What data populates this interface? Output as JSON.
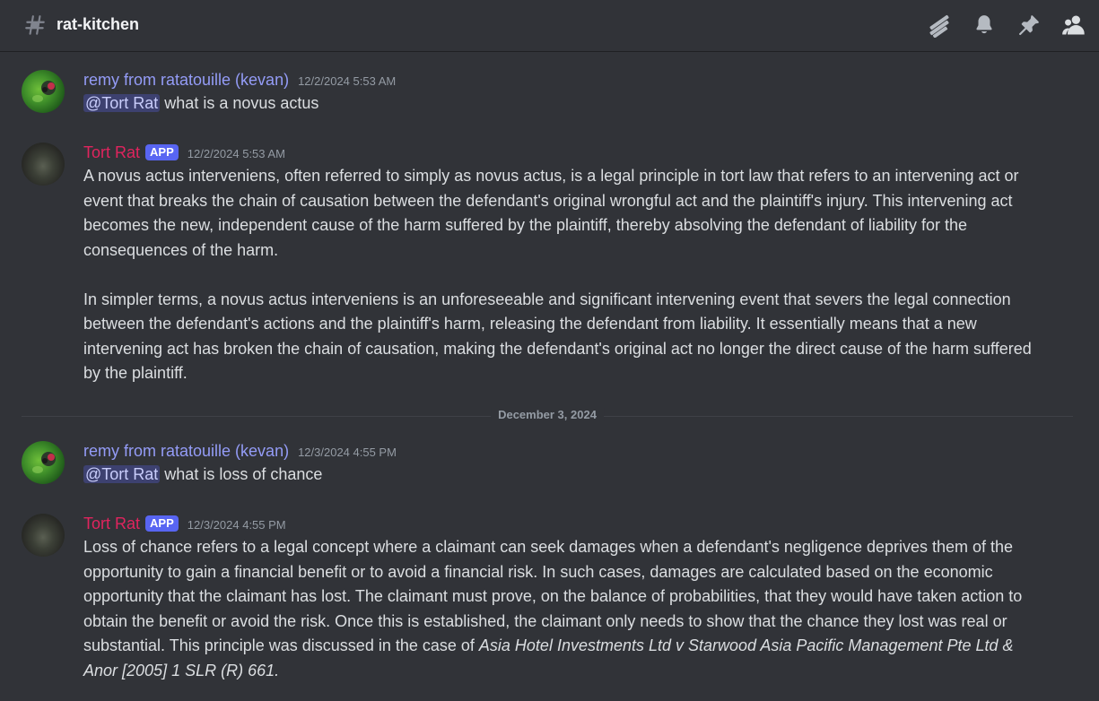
{
  "channel": {
    "name": "rat-kitchen"
  },
  "header_icons": [
    "threads-icon",
    "bell-icon",
    "pin-icon",
    "members-icon"
  ],
  "colors": {
    "background": "#313338",
    "remy_name": "#949cf7",
    "tort_name": "#e0245e",
    "app_badge": "#5865f2"
  },
  "messages": [
    {
      "author": "remy from ratatouille (kevan)",
      "timestamp": "12/2/2024 5:53 AM",
      "mention": "@Tort Rat",
      "text": " what is a novus actus"
    },
    {
      "author": "Tort Rat",
      "badge": "APP",
      "timestamp": "12/2/2024 5:53 AM",
      "paragraphs": [
        "A novus actus interveniens, often referred to simply as novus actus, is a legal principle in tort law that refers to an intervening act or event that breaks the chain of causation between the defendant's original wrongful act and the plaintiff's injury. This intervening act becomes the new, independent cause of the harm suffered by the plaintiff, thereby absolving the defendant of liability for the consequences of the harm.",
        "In simpler terms, a novus actus interveniens is an unforeseeable and significant intervening event that severs the legal connection between the defendant's actions and the plaintiff's harm, releasing the defendant from liability. It essentially means that a new intervening act has broken the chain of causation, making the defendant's original act no longer the direct cause of the harm suffered by the plaintiff."
      ]
    },
    {
      "author": "remy from ratatouille (kevan)",
      "timestamp": "12/3/2024 4:55 PM",
      "mention": "@Tort Rat",
      "text": " what is loss of chance"
    },
    {
      "author": "Tort Rat",
      "badge": "APP",
      "timestamp": "12/3/2024 4:55 PM",
      "text": "Loss of chance refers to a legal concept where a claimant can seek damages when a defendant's negligence deprives them of the opportunity to gain a financial benefit or to avoid a financial risk. In such cases, damages are calculated based on the economic opportunity that the claimant has lost. The claimant must prove, on the balance of probabilities, that they would have taken action to obtain the benefit or avoid the risk. Once this is established, the claimant only needs to show that the chance they lost was real or substantial. This principle was discussed in the case of ",
      "case_citation": "Asia Hotel Investments Ltd v Starwood Asia Pacific Management Pte Ltd & Anor [2005] 1 SLR (R) 661."
    }
  ],
  "date_divider": "December 3, 2024"
}
